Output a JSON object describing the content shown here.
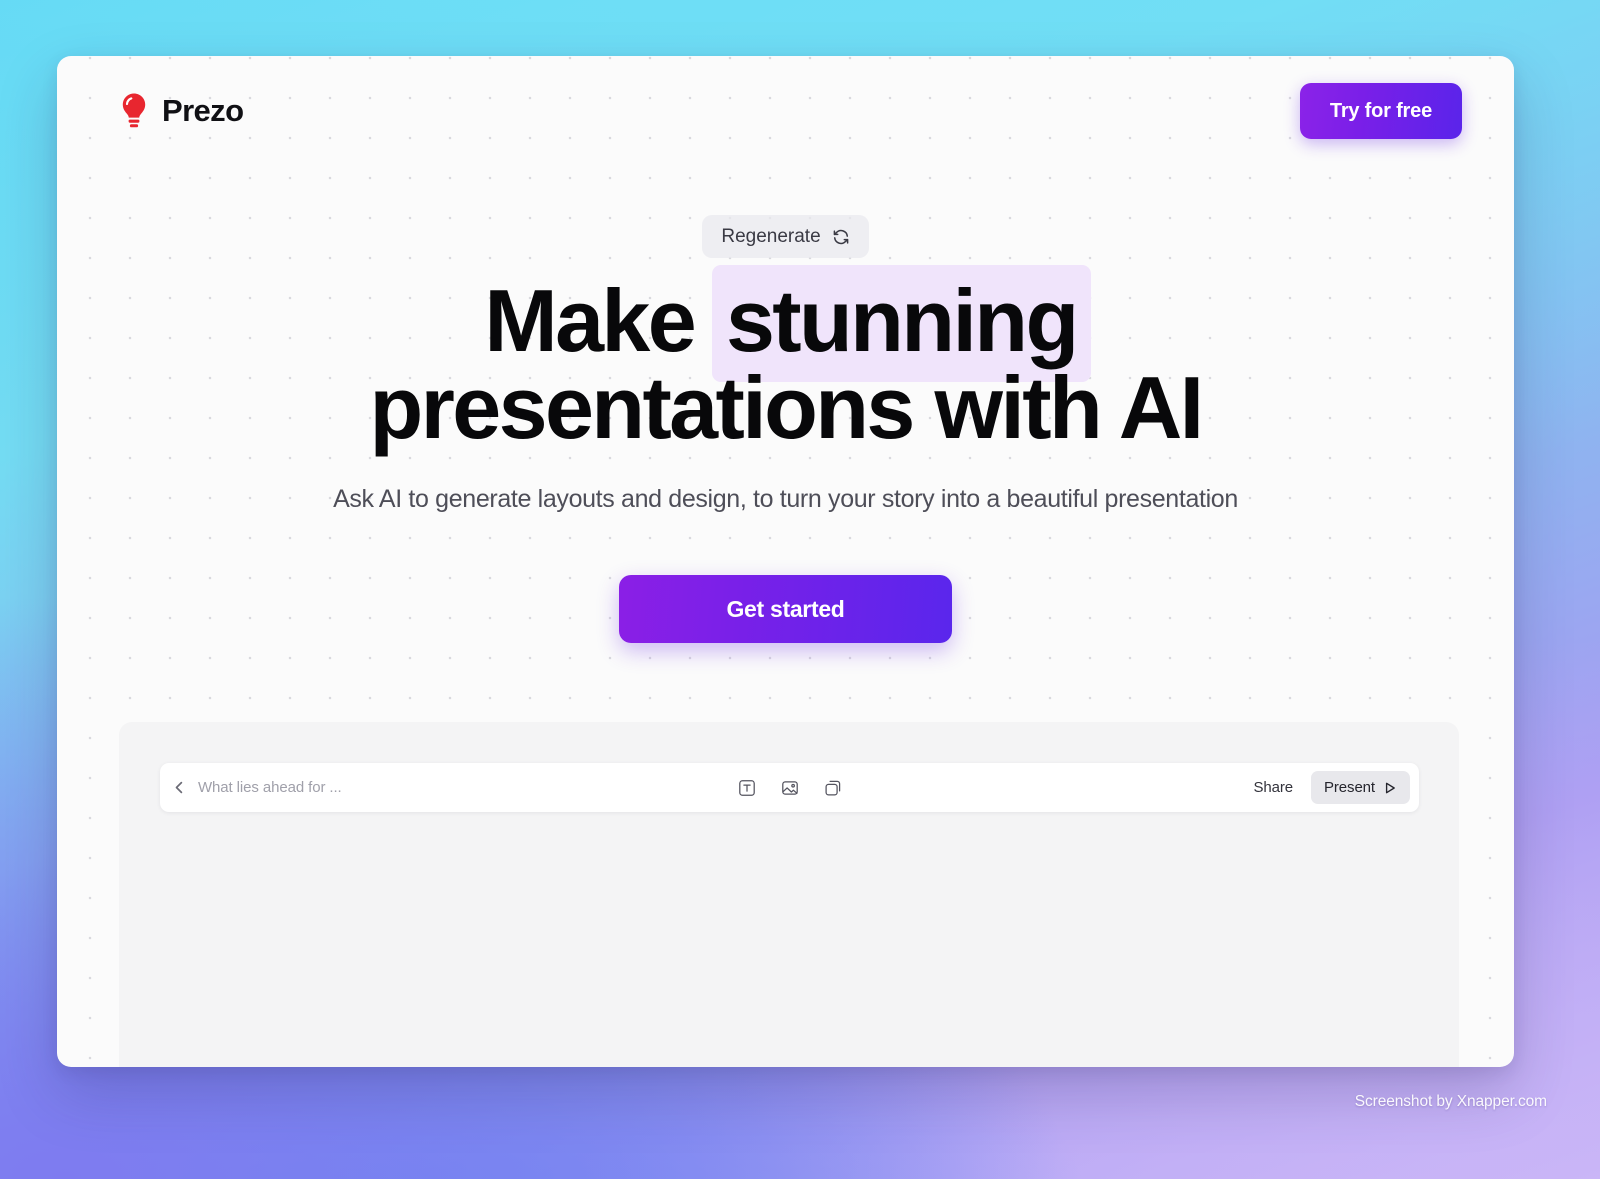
{
  "brand": {
    "name": "Prezo",
    "logo_icon": "lightbulb-icon",
    "logo_color": "#e8262f"
  },
  "header": {
    "cta_label": "Try for free",
    "cta_gradient_from": "#8b23e8",
    "cta_gradient_to": "#5a24ea"
  },
  "hero": {
    "regenerate_label": "Regenerate",
    "regenerate_icon": "refresh-icon",
    "headline_line1_plain": "Make",
    "headline_line1_highlight": "stunning",
    "headline_line2": "presentations with AI",
    "highlight_color": "#f0e4fb",
    "subheadline": "Ask AI to generate layouts and design, to turn your story into a beautiful presentation",
    "primary_cta_label": "Get started",
    "primary_cta_gradient_from": "#8b1fe6",
    "primary_cta_gradient_to": "#5a26ec"
  },
  "editor": {
    "back_icon": "chevron-left-icon",
    "document_title": "What lies ahead for ...",
    "tools": [
      {
        "name": "text-tool",
        "icon": "text-box-icon"
      },
      {
        "name": "image-tool",
        "icon": "image-icon"
      },
      {
        "name": "shape-tool",
        "icon": "shapes-icon"
      }
    ],
    "share_label": "Share",
    "present_label": "Present",
    "present_icon": "play-icon"
  },
  "watermark": {
    "text": "Screenshot by Xnapper.com"
  }
}
